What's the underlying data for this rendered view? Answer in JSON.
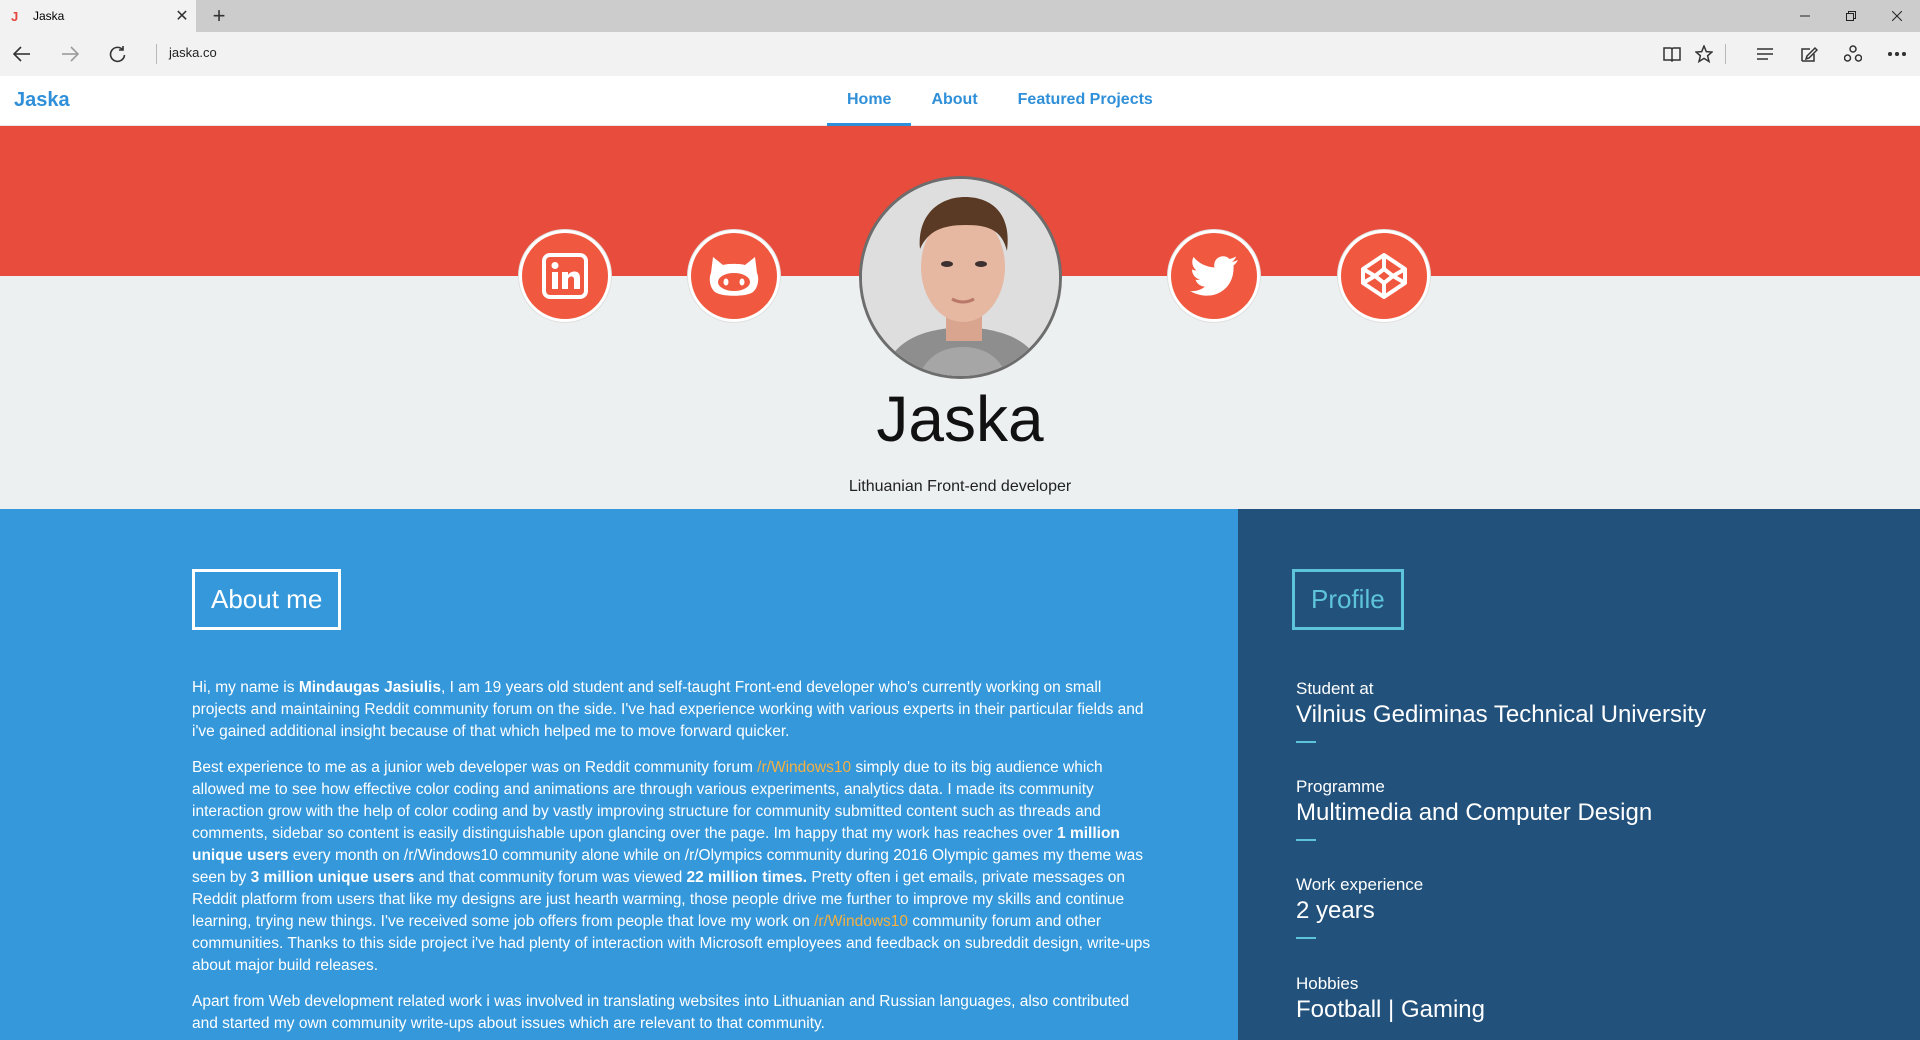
{
  "browser": {
    "tab_title": "Jaska",
    "tab_favicon": "J",
    "address": "jaska.co"
  },
  "site": {
    "brand": "Jaska",
    "menu": [
      "Home",
      "About",
      "Featured Projects"
    ],
    "active_menu": "Home"
  },
  "hero": {
    "name": "Jaska",
    "subtitle": "Lithuanian Front-end developer",
    "social": [
      "linkedin-icon",
      "github-icon",
      "twitter-icon",
      "codepen-icon"
    ]
  },
  "about": {
    "title": "About me",
    "p1": {
      "t1": "Hi, my name is ",
      "b1": "Mindaugas Jasiulis",
      "t2": ", I am 19 years old student and self-taught Front-end developer who's currently working on small projects and maintaining Reddit community forum on the side. I've had experience working with various experts in their particular fields and i've gained additional insight because of that which helped me to move forward quicker."
    },
    "p2": {
      "t1": "Best experience to me as a junior web developer was on Reddit community forum ",
      "link1": "/r/Windows10",
      "t2": " simply due to its big audience which allowed me to see how effective color coding and animations are through various experiments, analytics data. I made its community interaction grow with the help of color coding and by vastly improving structure for community submitted content such as threads and comments, sidebar so content is easily distinguishable upon glancing over the page. Im happy that my work has reaches over ",
      "b1": "1 million unique users",
      "t3": " every month on /r/Windows10 community alone while on /r/Olympics community during 2016 Olympic games my theme was seen by ",
      "b2": "3 million unique users",
      "t4": " and that community forum was viewed ",
      "b3": "22 million times.",
      "t5": " Pretty often i get emails, private messages on Reddit platform from users that like my designs are just hearth warming, those people drive me further to improve my skills and continue learning, trying new things. I've received some job offers from people that love my work on ",
      "link2": "/r/Windows10",
      "t6": " community forum and other communities. Thanks to this side project i've had plenty of interaction with Microsoft employees and feedback on subreddit design, write-ups about major build releases."
    },
    "p3": "Apart from Web development related work i was involved in translating websites into Lithuanian and Russian languages, also contributed and started my own community write-ups about issues which are relevant to that community."
  },
  "profile": {
    "title": "Profile",
    "items": [
      {
        "label": "Student at",
        "value": "Vilnius Gediminas Technical University"
      },
      {
        "label": "Programme",
        "value": "Multimedia and Computer Design"
      },
      {
        "label": "Work experience",
        "value": "2 years"
      },
      {
        "label": "Hobbies",
        "value": "Football | Gaming"
      }
    ]
  },
  "colors": {
    "accent": "#2f8fd8",
    "hero_red": "#e74c3c",
    "social_bg": "#f0593f",
    "about_bg": "#3498db",
    "profile_bg": "#22527c",
    "profile_accent": "#5dc4d9",
    "link": "#f5b041"
  }
}
